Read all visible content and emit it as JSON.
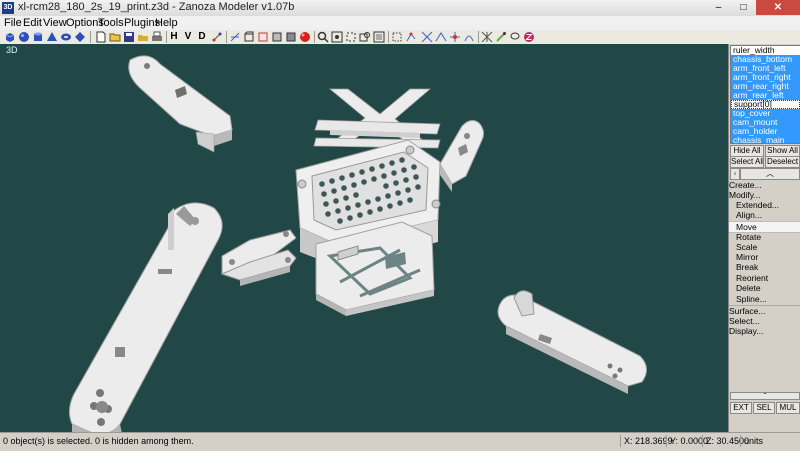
{
  "window": {
    "app_icon": "3D",
    "title": "xl-rcm28_180_2s_19_print.z3d - Zanoza Modeler v1.07b",
    "min": "–",
    "max": "□",
    "close": "✕"
  },
  "menu": [
    "File",
    "Edit",
    "View",
    "Options",
    "Tools",
    "Plugins",
    "Help"
  ],
  "toolbar": {
    "icons": [
      "cube-icon",
      "sphere-icon",
      "cylinder-icon",
      "cone-icon",
      "torus-icon",
      "diamond-icon",
      "new-file-icon",
      "open-folder-icon",
      "save-icon",
      "open-icon",
      "print-icon"
    ],
    "view_h": "H",
    "view_v": "V",
    "view_d": "D"
  },
  "viewport": {
    "label": "3D",
    "background": "#214747",
    "part_color": "#e6e6e6"
  },
  "objects": [
    {
      "name": "ruler_width",
      "selected": false
    },
    {
      "name": "chassis_bottom",
      "selected": true
    },
    {
      "name": "arm_front_left",
      "selected": true
    },
    {
      "name": "arm_front_right",
      "selected": true
    },
    {
      "name": "arm_rear_right",
      "selected": true
    },
    {
      "name": "arm_rear_left",
      "selected": true
    },
    {
      "name": "support[0]",
      "selected": false
    },
    {
      "name": "top_cover",
      "selected": true
    },
    {
      "name": "cam_mount",
      "selected": true
    },
    {
      "name": "cam_holder",
      "selected": true
    },
    {
      "name": "chassis_main",
      "selected": true
    }
  ],
  "panel": {
    "hide_all": "Hide All",
    "show_all": "Show All",
    "select_all": "Select All",
    "deselect": "Deselect",
    "ops": [
      "Create...",
      "Modify...",
      "Extended...",
      "Align...",
      "Move",
      "Rotate",
      "Scale",
      "Mirror",
      "Break",
      "Reorient",
      "Delete",
      "Spline...",
      "Surface...",
      "Select...",
      "Display..."
    ],
    "ext": "EXT",
    "sel": "SEL",
    "mul": "MUL"
  },
  "status": {
    "message": "0 object(s) is selected. 0 is hidden among them.",
    "x": "X: 218.3699",
    "y": "Y: 0.0000",
    "z": "Z: 30.4500",
    "units": "units"
  }
}
